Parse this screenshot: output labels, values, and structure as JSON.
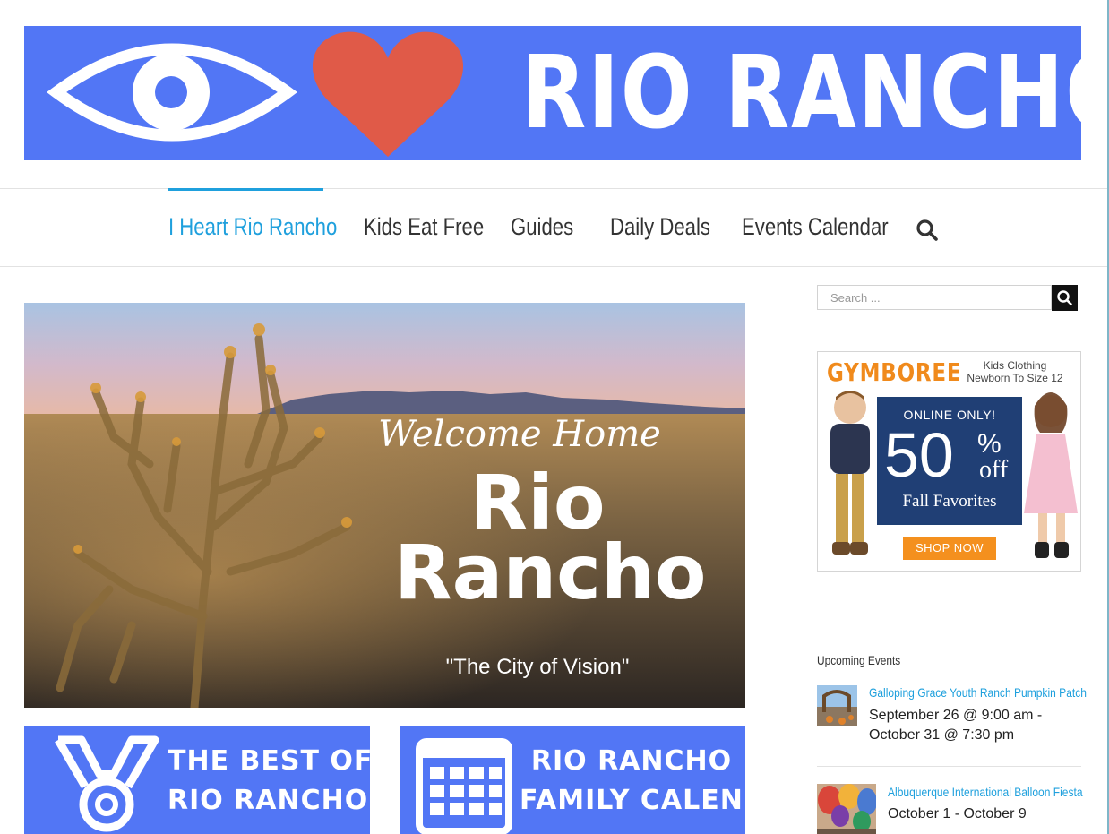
{
  "banner": {
    "title": "RIO RANCHO",
    "bg_color": "#5276f5",
    "heart_color": "#e05a48"
  },
  "nav": {
    "items": [
      {
        "label": "I Heart Rio Rancho",
        "active": true
      },
      {
        "label": "Kids Eat Free",
        "active": false
      },
      {
        "label": "Guides",
        "active": false
      },
      {
        "label": "Daily Deals",
        "active": false
      },
      {
        "label": "Events Calendar",
        "active": false
      }
    ],
    "accent_color": "#1fa0dd",
    "search_icon": "search-icon"
  },
  "hero": {
    "welcome": "Welcome Home",
    "city_line1": "Rio",
    "city_line2": "Rancho",
    "tagline": "\"The City of Vision\""
  },
  "promos": [
    {
      "line1": "THE BEST OF",
      "line2": "RIO RANCHO",
      "icon": "medal-icon"
    },
    {
      "line1": "RIO RANCHO",
      "line2": "FAMILY CALENDAR",
      "icon": "calendar-icon"
    }
  ],
  "sidebar": {
    "search": {
      "placeholder": "Search ..."
    },
    "ad": {
      "brand": "GYMBOREE",
      "sub_line1": "Kids Clothing",
      "sub_line2": "Newborn To Size 12",
      "online": "ONLINE ONLY!",
      "percent": "50",
      "percent_sign": "%",
      "off": "off",
      "fall": "Fall Favorites",
      "cta": "SHOP NOW"
    },
    "upcoming_title": "Upcoming Events",
    "events": [
      {
        "title": "Galloping Grace Youth Ranch Pumpkin Patch",
        "date_line1": "September 26 @ 9:00 am -",
        "date_line2": "October 31 @ 7:30 pm"
      },
      {
        "title": "Albuquerque International Balloon Fiesta",
        "date_line1": "October 1 - October 9",
        "date_line2": ""
      }
    ]
  }
}
